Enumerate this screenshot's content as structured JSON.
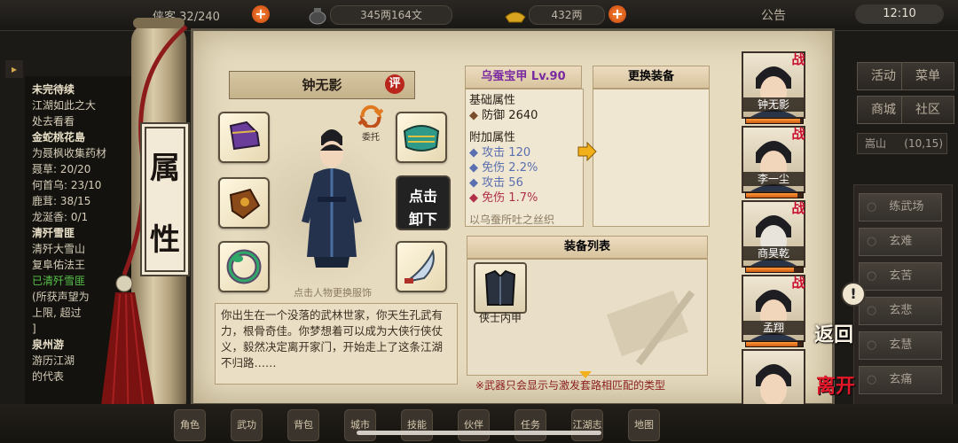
{
  "topbar": {
    "partial_label": "侠客",
    "capacity": "32/240",
    "money": "345两164文",
    "ingots": "432两",
    "notice": "公告",
    "time": "12:10"
  },
  "quests": [
    {
      "text": "未完待续",
      "color": "#e9e0c8"
    },
    {
      "text": "江湖如此之大",
      "color": "#d6cdb8"
    },
    {
      "text": "处去看看",
      "color": "#d6cdb8"
    },
    {
      "text": "金蛇桃花島",
      "color": "#e9e0c8"
    },
    {
      "text": "为聂枫收集药材",
      "color": "#d6cdb8"
    },
    {
      "text": "聂草: 20/20",
      "color": "#d6cdb8"
    },
    {
      "text": "何首乌: 23/10",
      "color": "#d6cdb8"
    },
    {
      "text": "鹿茸: 38/15",
      "color": "#d6cdb8"
    },
    {
      "text": "龙涎香: 0/1",
      "color": "#d6cdb8"
    },
    {
      "text": "清歼雪匪",
      "color": "#e9e0c8"
    },
    {
      "text": "清歼大雪山",
      "color": "#d6cdb8"
    },
    {
      "text": "复阜佑法王",
      "color": "#d6cdb8"
    },
    {
      "text": "已清歼雪匪",
      "color": "#57c24a"
    },
    {
      "text": "(所获声望为",
      "color": "#d6cdb8"
    },
    {
      "text": "上限, 超过",
      "color": "#d6cdb8"
    },
    {
      "text": "]",
      "color": "#d6cdb8"
    },
    {
      "text": "泉州游",
      "color": "#e9e0c8"
    },
    {
      "text": "游历江湖",
      "color": "#d6cdb8"
    },
    {
      "text": "的代表",
      "color": "#d6cdb8"
    }
  ],
  "scroll_label": {
    "line1": "属",
    "line2": "性"
  },
  "character": {
    "name": "钟无影",
    "rate_badge": "评",
    "entrust_label": "委托",
    "change_outfit_hint": "点击人物更换服饰",
    "unequip_line1": "点击",
    "unequip_line2": "卸下",
    "description": "你出生在一个没落的武林世家，你天生孔武有力，根骨奇佳。你梦想着可以成为大侠行侠仗义，毅然决定离开家门，开始走上了这条江湖不归路……"
  },
  "item": {
    "name": "乌蚕宝甲",
    "level": "Lv.90",
    "base_title": "基础属性",
    "base_stats": [
      {
        "label": "防御",
        "value": "2640",
        "color": "#7a4e2c"
      }
    ],
    "extra_title": "附加属性",
    "extra_stats": [
      {
        "label": "攻击",
        "value": "120",
        "color": "#5a6fb0"
      },
      {
        "label": "免伤",
        "value": "2.2%",
        "color": "#5a6fb0"
      },
      {
        "label": "攻击",
        "value": "56",
        "color": "#5a6fb0"
      },
      {
        "label": "免伤",
        "value": "1.7%",
        "color": "#b0304a"
      }
    ],
    "flavor": "以乌蚕所吐之丝织"
  },
  "replace_title": "更换装备",
  "equip_list": {
    "title": "装备列表",
    "items": [
      {
        "name": "侠士内甲"
      }
    ],
    "footer": "※武器只会显示与激发套路相匹配的类型"
  },
  "party": [
    {
      "name": "钟无影",
      "xp": 0.95,
      "battle": "战"
    },
    {
      "name": "李一尘",
      "xp": 0.9,
      "battle": "战"
    },
    {
      "name": "商昊乾",
      "xp": 0.85,
      "battle": "战"
    },
    {
      "name": "孟翔",
      "xp": 0.9,
      "battle": "战"
    },
    {
      "name": "",
      "xp": 0.8,
      "battle": ""
    }
  ],
  "right_menu": {
    "activity": "活动",
    "menu": "菜单",
    "shop": "商城",
    "community": "社区",
    "location": "嵩山",
    "coords": "(10,15)",
    "places": [
      "练武场",
      "玄难",
      "玄苦",
      "玄悲",
      "玄慧",
      "玄痛"
    ]
  },
  "actions": {
    "return": "返回",
    "leave": "离开"
  },
  "bottom_nav": [
    "角色",
    "武功",
    "背包",
    "城市",
    "技能",
    "伙伴",
    "任务",
    "江湖志",
    "地图"
  ]
}
